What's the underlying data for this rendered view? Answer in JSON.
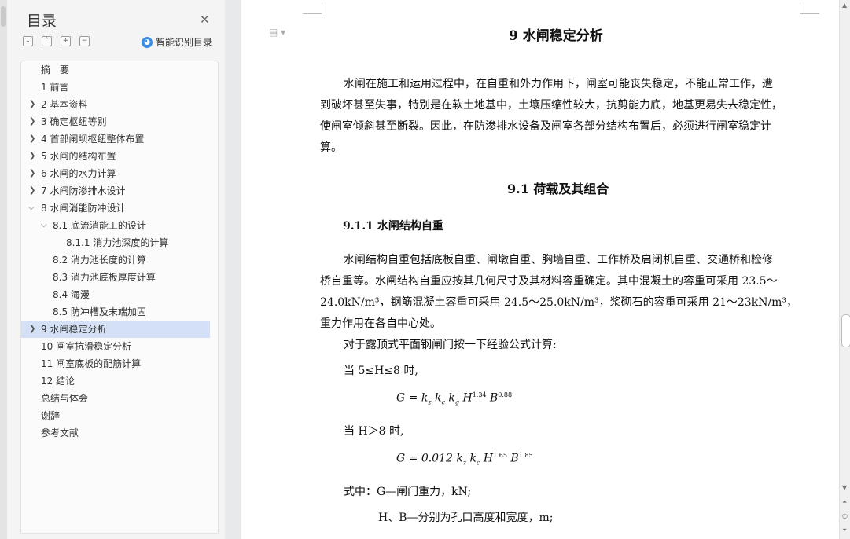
{
  "toc": {
    "title": "目录",
    "smart_label": "智能识别目录",
    "items": [
      {
        "label": "摘　要"
      },
      {
        "label": "1 前言"
      },
      {
        "label": "2 基本资料"
      },
      {
        "label": "3  确定枢纽等别"
      },
      {
        "label": "4 首部闸坝枢纽整体布置"
      },
      {
        "label": "5 水闸的结构布置"
      },
      {
        "label": "6 水闸的水力计算"
      },
      {
        "label": "7 水闸防渗排水设计"
      },
      {
        "label": "8 水闸消能防冲设计"
      },
      {
        "label": "8.1 底流消能工的设计"
      },
      {
        "label": "8.1.1 消力池深度的计算"
      },
      {
        "label": "8.2 消力池长度的计算"
      },
      {
        "label": "8.3 消力池底板厚度计算"
      },
      {
        "label": "8.4  海漫"
      },
      {
        "label": "8.5  防冲槽及末端加固"
      },
      {
        "label": "9 水闸稳定分析"
      },
      {
        "label": "10 闸室抗滑稳定分析"
      },
      {
        "label": "11 闸室底板的配筋计算"
      },
      {
        "label": "12 结论"
      },
      {
        "label": "总结与体会"
      },
      {
        "label": "谢辞"
      },
      {
        "label": "参考文献"
      }
    ]
  },
  "doc": {
    "title": "9 水闸稳定分析",
    "para1": [
      "水闸在施工和运用过程中，在自重和外力作用下，闸室可能丧失稳定，不能正常工作，遭",
      "到破坏甚至失事，特别是在软土地基中，土壤压缩性较大，抗剪能力底，地基更易失去稳定性，",
      "使闸室倾斜甚至断裂。因此，在防渗排水设备及闸室各部分结构布置后，必须进行闸室稳定计",
      "算。"
    ],
    "h2": "9.1 荷载及其组合",
    "h3": "9.1.1 水闸结构自重",
    "para2": [
      "水闸结构自重包括底板自重、闸墩自重、胸墙自重、工作桥及启闭机自重、交通桥和检修",
      "桥自重等。水闸结构自重应按其几何尺寸及其材料容重确定。其中混凝土的容重可采用 23.5～",
      "24.0kN/m³，钢筋混凝土容重可采用 24.5～25.0kN/m³，浆砌石的容重可采用 21～23kN/m³，",
      "重力作用在各自中心处。"
    ],
    "formula_intro": "对于露顶式平面钢闸门按一下经验公式计算:",
    "cond1": "当 5≤H≤8 时,",
    "eq1": "G = k_z k_c k_g H^1.34 B^0.88",
    "cond2": "当 H＞8 时,",
    "eq2": "G = 0.012 k_z k_c H^1.65 B^1.85",
    "where1": "式中：G—闸门重力，kN;",
    "where2": "H、B—分别为孔口高度和宽度，m;"
  }
}
